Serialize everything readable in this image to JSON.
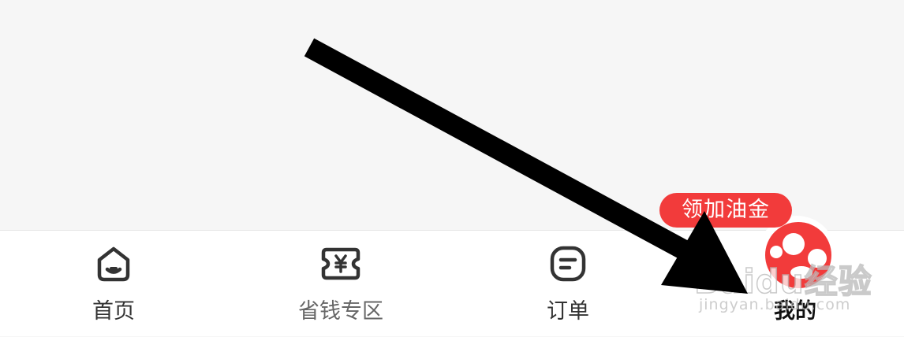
{
  "tabbar": {
    "tabs": [
      {
        "id": "home",
        "label": "首页",
        "icon": "home-icon"
      },
      {
        "id": "save",
        "label": "省钱专区",
        "icon": "coupon-yen-icon"
      },
      {
        "id": "orders",
        "label": "订单",
        "icon": "order-list-icon"
      },
      {
        "id": "mine",
        "label": "我的",
        "icon": "profile-avatar-icon"
      }
    ],
    "active_tab": "mine"
  },
  "promo_badge": {
    "text": "领加油金"
  },
  "watermark": {
    "brand": "Baidu经验",
    "url": "jingyan.baidu.com"
  },
  "colors": {
    "accent_red": "#f23b3b",
    "icon_dark": "#333333",
    "label_muted": "#666666",
    "background": "#f6f6f6",
    "tabbar_bg": "#ffffff",
    "annotation_arrow": "#000000"
  }
}
